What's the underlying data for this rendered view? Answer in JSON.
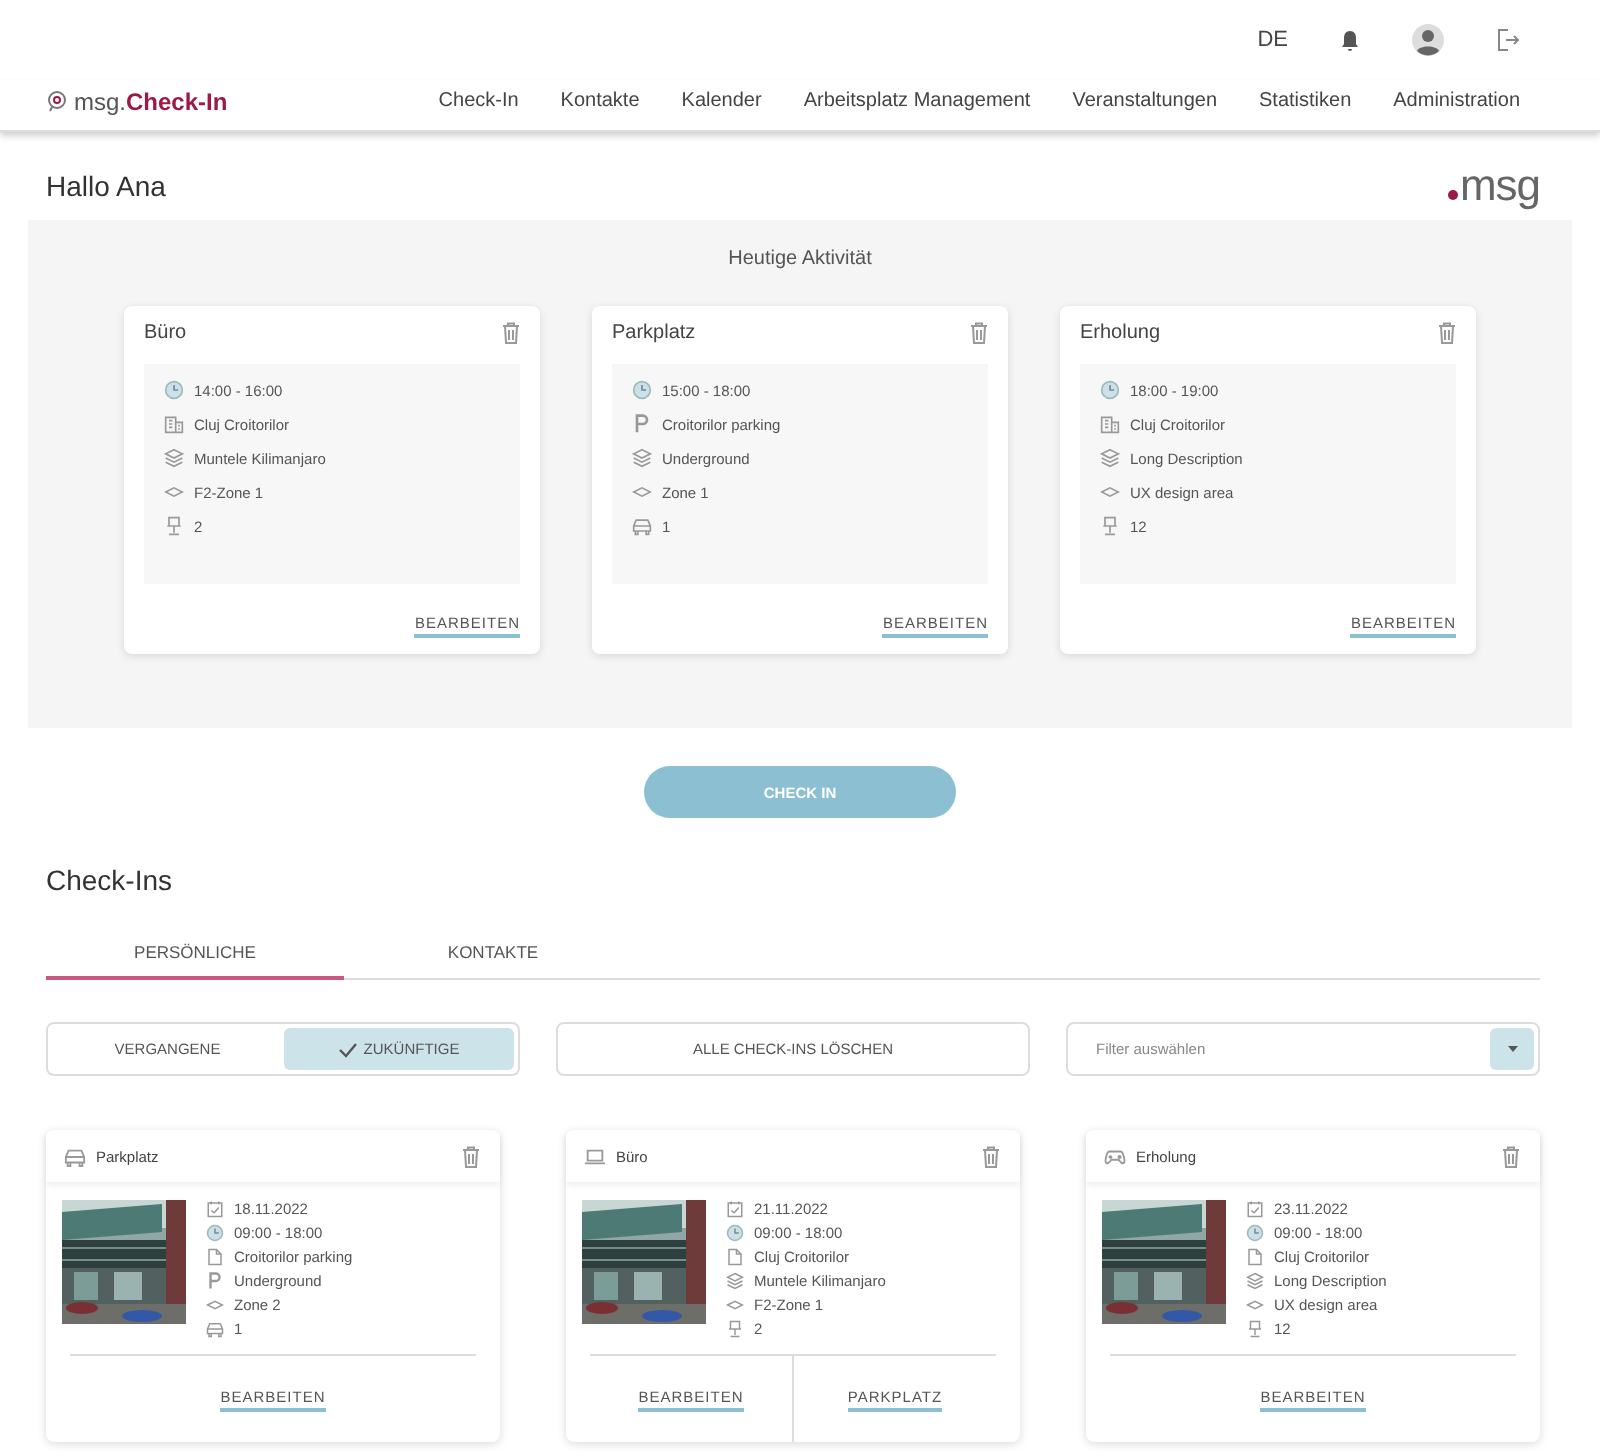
{
  "topbar": {
    "language": "DE"
  },
  "brand": {
    "prefix": "msg.",
    "name": "Check-In"
  },
  "nav": [
    {
      "label": "Check-In"
    },
    {
      "label": "Kontakte"
    },
    {
      "label": "Kalender"
    },
    {
      "label": "Arbeitsplatz Management"
    },
    {
      "label": "Veranstaltungen"
    },
    {
      "label": "Statistiken"
    },
    {
      "label": "Administration"
    }
  ],
  "greeting": "Hallo Ana",
  "logo": {
    "text": "msg"
  },
  "today": {
    "title": "Heutige Aktivität",
    "cards": [
      {
        "title": "Büro",
        "details": [
          {
            "kind": "time",
            "text": "14:00 - 16:00"
          },
          {
            "kind": "building",
            "text": "Cluj Croitorilor"
          },
          {
            "kind": "layers",
            "text": "Muntele Kilimanjaro"
          },
          {
            "kind": "zone",
            "text": "F2-Zone 1"
          },
          {
            "kind": "desk",
            "text": "2"
          }
        ],
        "action": "BEARBEITEN"
      },
      {
        "title": "Parkplatz",
        "details": [
          {
            "kind": "time",
            "text": "15:00 - 18:00"
          },
          {
            "kind": "parking",
            "text": "Croitorilor parking"
          },
          {
            "kind": "layers",
            "text": "Underground"
          },
          {
            "kind": "zone",
            "text": "Zone 1"
          },
          {
            "kind": "car",
            "text": "1"
          }
        ],
        "action": "BEARBEITEN"
      },
      {
        "title": "Erholung",
        "details": [
          {
            "kind": "time",
            "text": "18:00 - 19:00"
          },
          {
            "kind": "building",
            "text": "Cluj Croitorilor"
          },
          {
            "kind": "layers",
            "text": "Long Description"
          },
          {
            "kind": "zone",
            "text": "UX design area"
          },
          {
            "kind": "desk",
            "text": "12"
          }
        ],
        "action": "BEARBEITEN"
      }
    ]
  },
  "checkin_button": "CHECK IN",
  "checkins": {
    "title": "Check-Ins",
    "tabs": [
      {
        "label": "PERSÖNLICHE",
        "selected": true
      },
      {
        "label": "KONTAKTE",
        "selected": false
      }
    ],
    "toggle": [
      {
        "label": "VERGANGENE",
        "selected": false
      },
      {
        "label": "ZUKÜNFTIGE",
        "selected": true
      }
    ],
    "delete_all": "ALLE CHECK-INS LÖSCHEN",
    "filter": {
      "placeholder": "Filter auswählen"
    },
    "cards": [
      {
        "kind": "car",
        "title": "Parkplatz",
        "details": [
          {
            "kind": "date",
            "text": "18.11.2022"
          },
          {
            "kind": "time",
            "text": "09:00 - 18:00"
          },
          {
            "kind": "document",
            "text": "Croitorilor parking"
          },
          {
            "kind": "parking",
            "text": "Underground"
          },
          {
            "kind": "zone",
            "text": "Zone 2"
          },
          {
            "kind": "car",
            "text": "1"
          }
        ],
        "actions": [
          "BEARBEITEN"
        ]
      },
      {
        "kind": "laptop",
        "title": "Büro",
        "details": [
          {
            "kind": "date",
            "text": "21.11.2022"
          },
          {
            "kind": "time",
            "text": "09:00 - 18:00"
          },
          {
            "kind": "document",
            "text": "Cluj Croitorilor"
          },
          {
            "kind": "layers",
            "text": "Muntele Kilimanjaro"
          },
          {
            "kind": "zone",
            "text": "F2-Zone 1"
          },
          {
            "kind": "desk",
            "text": "2"
          }
        ],
        "actions": [
          "BEARBEITEN",
          "PARKPLATZ"
        ]
      },
      {
        "kind": "gamepad",
        "title": "Erholung",
        "details": [
          {
            "kind": "date",
            "text": "23.11.2022"
          },
          {
            "kind": "time",
            "text": "09:00 - 18:00"
          },
          {
            "kind": "document",
            "text": "Cluj Croitorilor"
          },
          {
            "kind": "layers",
            "text": "Long Description"
          },
          {
            "kind": "zone",
            "text": "UX design area"
          },
          {
            "kind": "desk",
            "text": "12"
          }
        ],
        "actions": [
          "BEARBEITEN"
        ]
      }
    ]
  }
}
